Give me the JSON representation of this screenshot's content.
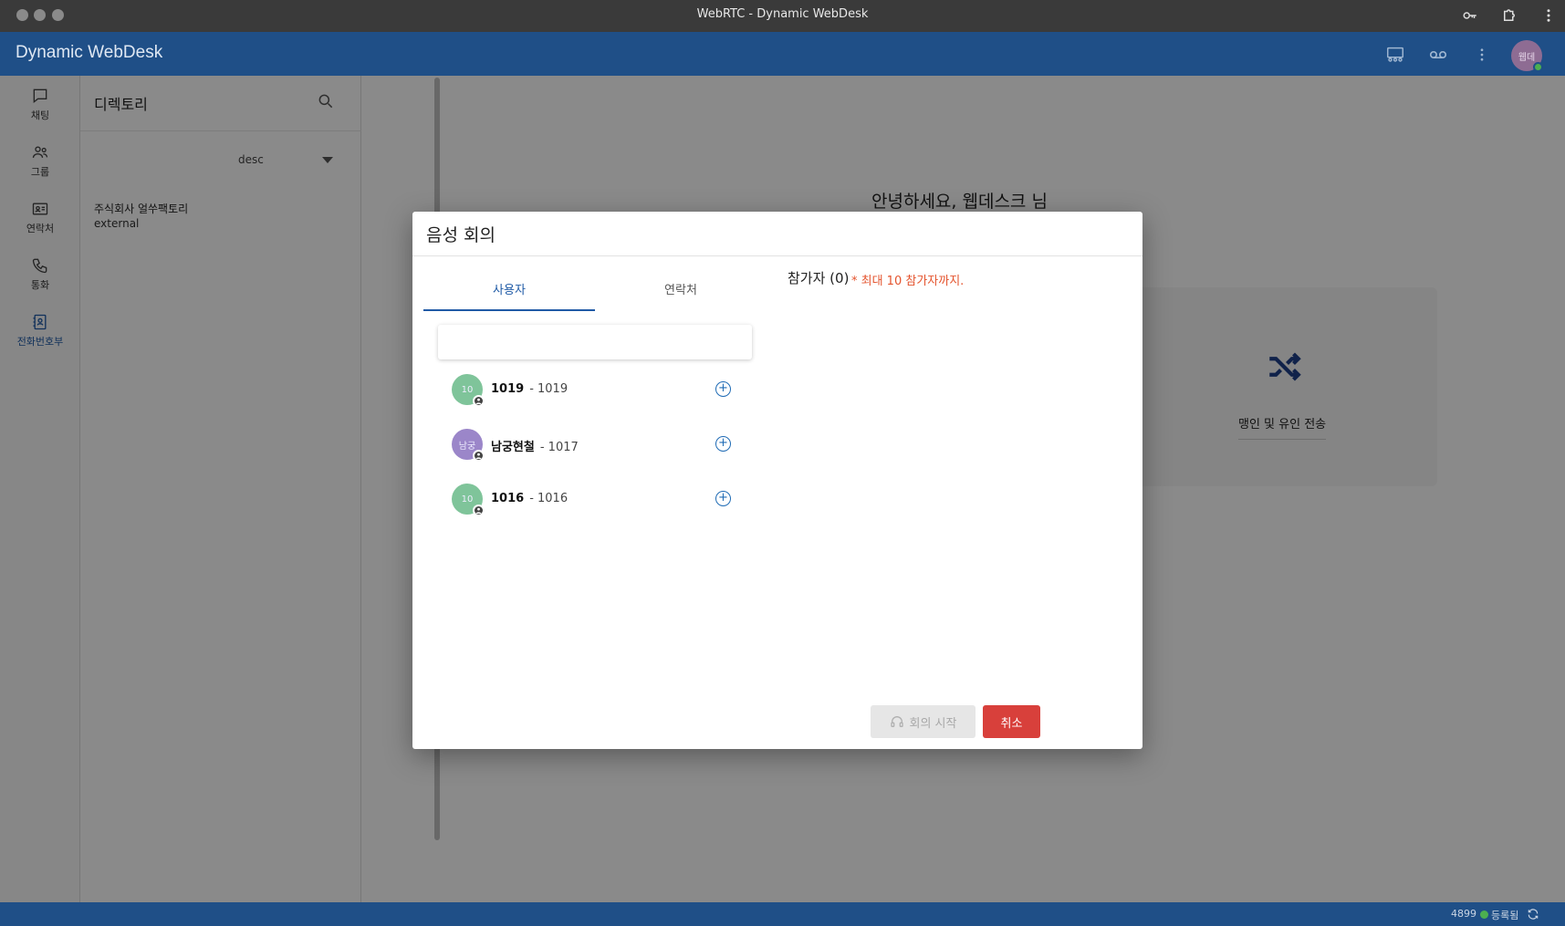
{
  "window": {
    "title": "WebRTC - Dynamic WebDesk"
  },
  "app": {
    "title": "Dynamic WebDesk",
    "avatar_initials": "웹데"
  },
  "nav": {
    "items": [
      {
        "label": "채팅",
        "icon": "chat-icon"
      },
      {
        "label": "그룹",
        "icon": "group-icon"
      },
      {
        "label": "연락처",
        "icon": "contact-card-icon"
      },
      {
        "label": "통화",
        "icon": "phone-icon"
      },
      {
        "label": "전화번호부",
        "icon": "phonebook-icon"
      }
    ],
    "active_index": 4
  },
  "directory": {
    "title": "디렉토리",
    "sort": "desc",
    "company": "주식회사 얼쑤팩토리",
    "company_sub": "external"
  },
  "main": {
    "greeting": "안녕하세요, 웹데스크 님",
    "card_label": "맹인 및 유인 전송"
  },
  "dialog": {
    "title": "음성 회의",
    "tabs": [
      "사용자",
      "연락처"
    ],
    "active_tab": 0,
    "search_value": "",
    "users": [
      {
        "avatar": "10",
        "name": "1019",
        "ext": "- 1019",
        "color": "#7fc49a"
      },
      {
        "avatar": "남궁",
        "name": "남궁현철",
        "ext": "- 1017",
        "color": "#9b86c9"
      },
      {
        "avatar": "10",
        "name": "1016",
        "ext": "- 1016",
        "color": "#7fc49a"
      }
    ],
    "participants_label": "참가자 (0)",
    "participants_note": "* 최대 10 참가자까지.",
    "start_button": "회의 시작",
    "cancel_button": "취소"
  },
  "status": {
    "extension": "4899",
    "registered": "등록됨"
  },
  "colors": {
    "brand": "#1f4f87",
    "accent": "#1f5aa6",
    "danger": "#d8403b",
    "note": "#e4532d"
  }
}
